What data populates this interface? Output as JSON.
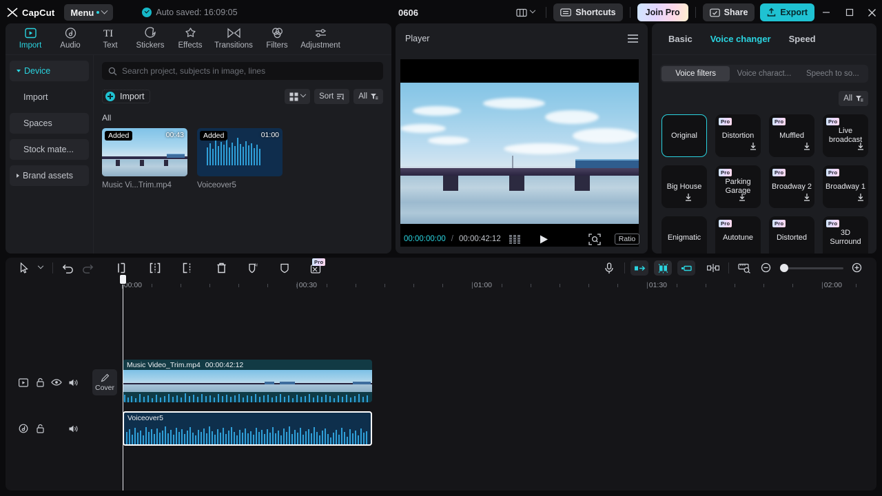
{
  "titlebar": {
    "app_name": "CapCut",
    "menu_label": "Menu",
    "autosave_text": "Auto saved: 16:09:05",
    "project_name": "0606",
    "shortcuts_label": "Shortcuts",
    "join_pro_label": "Join Pro",
    "share_label": "Share",
    "export_label": "Export",
    "icons": {
      "layout": "layout-icon",
      "shortcuts": "keyboard-icon",
      "share": "share-icon",
      "export": "upload-icon",
      "minimize": "minimize-icon",
      "maximize": "maximize-icon",
      "close": "close-icon"
    },
    "accent_cyan": "#2ad4e0",
    "export_bg": "#1fc2d2"
  },
  "nav_tabs": [
    {
      "label": "Import",
      "icon": "import-icon",
      "active": true
    },
    {
      "label": "Audio",
      "icon": "audio-note-icon",
      "active": false
    },
    {
      "label": "Text",
      "icon": "text-ti-icon",
      "active": false
    },
    {
      "label": "Stickers",
      "icon": "sticker-icon",
      "active": false
    },
    {
      "label": "Effects",
      "icon": "effects-star-icon",
      "active": false
    },
    {
      "label": "Transitions",
      "icon": "transitions-icon",
      "active": false
    },
    {
      "label": "Filters",
      "icon": "filters-circles-icon",
      "active": false
    },
    {
      "label": "Adjustment",
      "icon": "adjustment-sliders-icon",
      "active": false
    }
  ],
  "sidebar": {
    "items": [
      {
        "label": "Device",
        "active": true,
        "expander": "down",
        "filled": true
      },
      {
        "label": "Import",
        "active": false,
        "expander": "none",
        "filled": false
      },
      {
        "label": "Spaces",
        "active": false,
        "expander": "none",
        "filled": true
      },
      {
        "label": "Stock mate...",
        "active": false,
        "expander": "none",
        "filled": true
      },
      {
        "label": "Brand assets",
        "active": false,
        "expander": "right",
        "filled": true
      }
    ]
  },
  "media": {
    "search_placeholder": "Search project, subjects in image, lines",
    "search_value": "",
    "import_label": "Import",
    "sort_label": "Sort",
    "filter_label": "All",
    "section_label": "All",
    "items": [
      {
        "name": "Music Vi...Trim.mp4",
        "duration": "00:43",
        "badge": "Added",
        "kind": "video"
      },
      {
        "name": "Voiceover5",
        "duration": "01:00",
        "badge": "Added",
        "kind": "audio"
      }
    ]
  },
  "player": {
    "title": "Player",
    "current_time": "00:00:00:00",
    "separator": "/",
    "total_time": "00:00:42:12",
    "ratio_label": "Ratio",
    "icons": {
      "menu": "hamburger-icon",
      "frames": "frame-grid-icon",
      "play": "play-icon",
      "zoom": "magnifier-icon",
      "fullscreen": "fullscreen-icon"
    }
  },
  "right_panel": {
    "tabs": [
      {
        "label": "Basic",
        "active": false
      },
      {
        "label": "Voice changer",
        "active": true
      },
      {
        "label": "Speed",
        "active": false
      }
    ],
    "segments": [
      {
        "label": "Voice filters",
        "active": true
      },
      {
        "label": "Voice charact...",
        "active": false
      },
      {
        "label": "Speech to so...",
        "active": false
      }
    ],
    "filter_label": "All",
    "tiles": [
      {
        "name": "Original",
        "pro": false,
        "download": false,
        "selected": true
      },
      {
        "name": "Distortion",
        "pro": true,
        "download": true,
        "selected": false
      },
      {
        "name": "Muffled",
        "pro": true,
        "download": true,
        "selected": false
      },
      {
        "name": "Live broadcast",
        "pro": true,
        "download": true,
        "selected": false
      },
      {
        "name": "Big House",
        "pro": false,
        "download": true,
        "selected": false
      },
      {
        "name": "Parking Garage",
        "pro": true,
        "download": true,
        "selected": false
      },
      {
        "name": "Broadway 2",
        "pro": true,
        "download": true,
        "selected": false
      },
      {
        "name": "Broadway 1",
        "pro": true,
        "download": true,
        "selected": false
      },
      {
        "name": "Enigmatic",
        "pro": false,
        "download": false,
        "selected": false
      },
      {
        "name": "Autotune",
        "pro": true,
        "download": false,
        "selected": false
      },
      {
        "name": "Distorted",
        "pro": true,
        "download": false,
        "selected": false
      },
      {
        "name": "3D Surround",
        "pro": true,
        "download": false,
        "selected": false
      }
    ]
  },
  "timeline": {
    "toolbar_left": [
      {
        "icon": "select-cursor-icon",
        "name": "select-tool"
      },
      {
        "icon": "chevron-down-icon",
        "name": "tool-dropdown"
      },
      {
        "icon": "undo-icon",
        "name": "undo-button"
      },
      {
        "icon": "redo-icon",
        "name": "redo-button"
      },
      {
        "icon": "split-icon",
        "name": "split-button"
      },
      {
        "icon": "trim-left-icon",
        "name": "trim-left-button"
      },
      {
        "icon": "trim-right-icon",
        "name": "trim-right-button"
      },
      {
        "icon": "delete-icon",
        "name": "delete-button"
      },
      {
        "icon": "ai-shield-icon",
        "name": "ai-mask-button"
      },
      {
        "icon": "shield-icon",
        "name": "mask-button"
      },
      {
        "icon": "mute-scissors-icon",
        "name": "remove-silence-button",
        "pro": true
      }
    ],
    "toolbar_right": [
      {
        "icon": "microphone-icon",
        "name": "record-voiceover-button"
      },
      {
        "icon": "snap-left-icon",
        "name": "snap-start-button"
      },
      {
        "icon": "magnet-icon",
        "name": "magnet-button"
      },
      {
        "icon": "snap-right-icon",
        "name": "snap-end-button"
      },
      {
        "icon": "split-preview-icon",
        "name": "split-view-button"
      },
      {
        "icon": "ruler-zoom-icon",
        "name": "fit-timeline-button"
      },
      {
        "icon": "zoom-out-icon",
        "name": "zoom-out-button"
      },
      {
        "icon": "zoom-in-icon",
        "name": "zoom-in-button"
      }
    ],
    "zoom_value": 5,
    "ruler_labels": [
      "00:00",
      "00:30",
      "01:00",
      "01:30",
      "02:00"
    ],
    "playhead_time": "00:00",
    "cover_label": "Cover",
    "video_track": {
      "clip_name": "Music Video_Trim.mp4",
      "clip_duration": "00:00:42:12",
      "header_icons": [
        "track-video-icon",
        "lock-icon",
        "eye-icon",
        "speaker-icon"
      ]
    },
    "audio_track": {
      "clip_name": "Voiceover5",
      "selected": true,
      "header_icons": [
        "music-note-icon",
        "lock-icon",
        "speaker-icon"
      ]
    }
  }
}
